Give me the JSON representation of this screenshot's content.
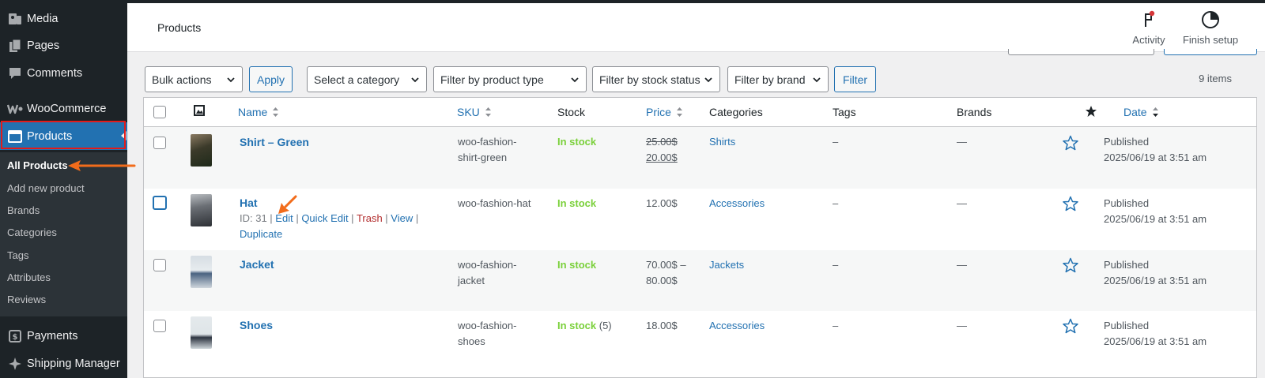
{
  "sidebar": {
    "items": [
      {
        "label": "Media",
        "icon": "media-icon"
      },
      {
        "label": "Pages",
        "icon": "pages-icon"
      },
      {
        "label": "Comments",
        "icon": "comments-icon"
      },
      {
        "label": "WooCommerce",
        "icon": "woocommerce-icon"
      },
      {
        "label": "Products",
        "icon": "products-icon"
      }
    ],
    "submenu": [
      "All Products",
      "Add new product",
      "Brands",
      "Categories",
      "Tags",
      "Attributes",
      "Reviews"
    ],
    "bottom": [
      {
        "label": "Payments",
        "icon": "payments-icon"
      },
      {
        "label": "Shipping Manager",
        "icon": "shipping-icon"
      }
    ]
  },
  "header": {
    "title": "Products",
    "activity_label": "Activity",
    "finish_setup_label": "Finish setup"
  },
  "filters": {
    "bulk_actions": "Bulk actions",
    "apply": "Apply",
    "category": "Select a category",
    "product_type": "Filter by product type",
    "stock_status": "Filter by stock status",
    "brand": "Filter by brand",
    "filter": "Filter",
    "items_count": "9 items"
  },
  "table": {
    "columns": {
      "name": "Name",
      "sku": "SKU",
      "stock": "Stock",
      "price": "Price",
      "categories": "Categories",
      "tags": "Tags",
      "brands": "Brands",
      "date": "Date"
    },
    "rows": [
      {
        "name": "Shirt – Green",
        "sku": [
          "woo-fashion-",
          "shirt-green"
        ],
        "stock": "In stock",
        "stock_count": "",
        "price_regular": "25.00$",
        "price_sale": "20.00$",
        "category": "Shirts",
        "tags": "–",
        "brands": "—",
        "date_status": "Published",
        "date": "2025/06/19 at 3:51 am"
      },
      {
        "name": "Hat",
        "sku": [
          "woo-fashion-hat"
        ],
        "stock": "In stock",
        "stock_count": "",
        "price": "12.00$",
        "category": "Accessories",
        "tags": "–",
        "brands": "—",
        "date_status": "Published",
        "date": "2025/06/19 at 3:51 am",
        "row_actions": {
          "id": "ID: 31",
          "edit": "Edit",
          "quick_edit": "Quick Edit",
          "trash": "Trash",
          "view": "View",
          "duplicate": "Duplicate"
        }
      },
      {
        "name": "Jacket",
        "sku": [
          "woo-fashion-",
          "jacket"
        ],
        "stock": "In stock",
        "stock_count": "",
        "price_range": [
          "70.00$ –",
          "80.00$"
        ],
        "category": "Jackets",
        "tags": "–",
        "brands": "—",
        "date_status": "Published",
        "date": "2025/06/19 at 3:51 am"
      },
      {
        "name": "Shoes",
        "sku": [
          "woo-fashion-",
          "shoes"
        ],
        "stock": "In stock",
        "stock_count": "(5)",
        "price": "18.00$",
        "category": "Accessories",
        "tags": "–",
        "brands": "—",
        "date_status": "Published",
        "date": "2025/06/19 at 3:51 am"
      }
    ]
  },
  "colors": {
    "sidebar_bg": "#1d2327",
    "submenu_bg": "#2c3338",
    "accent": "#2271b1",
    "in_stock": "#7ad03a",
    "trash": "#b32d2e",
    "annotation": "#f26c1b",
    "highlight_outline": "#e21b1b"
  }
}
